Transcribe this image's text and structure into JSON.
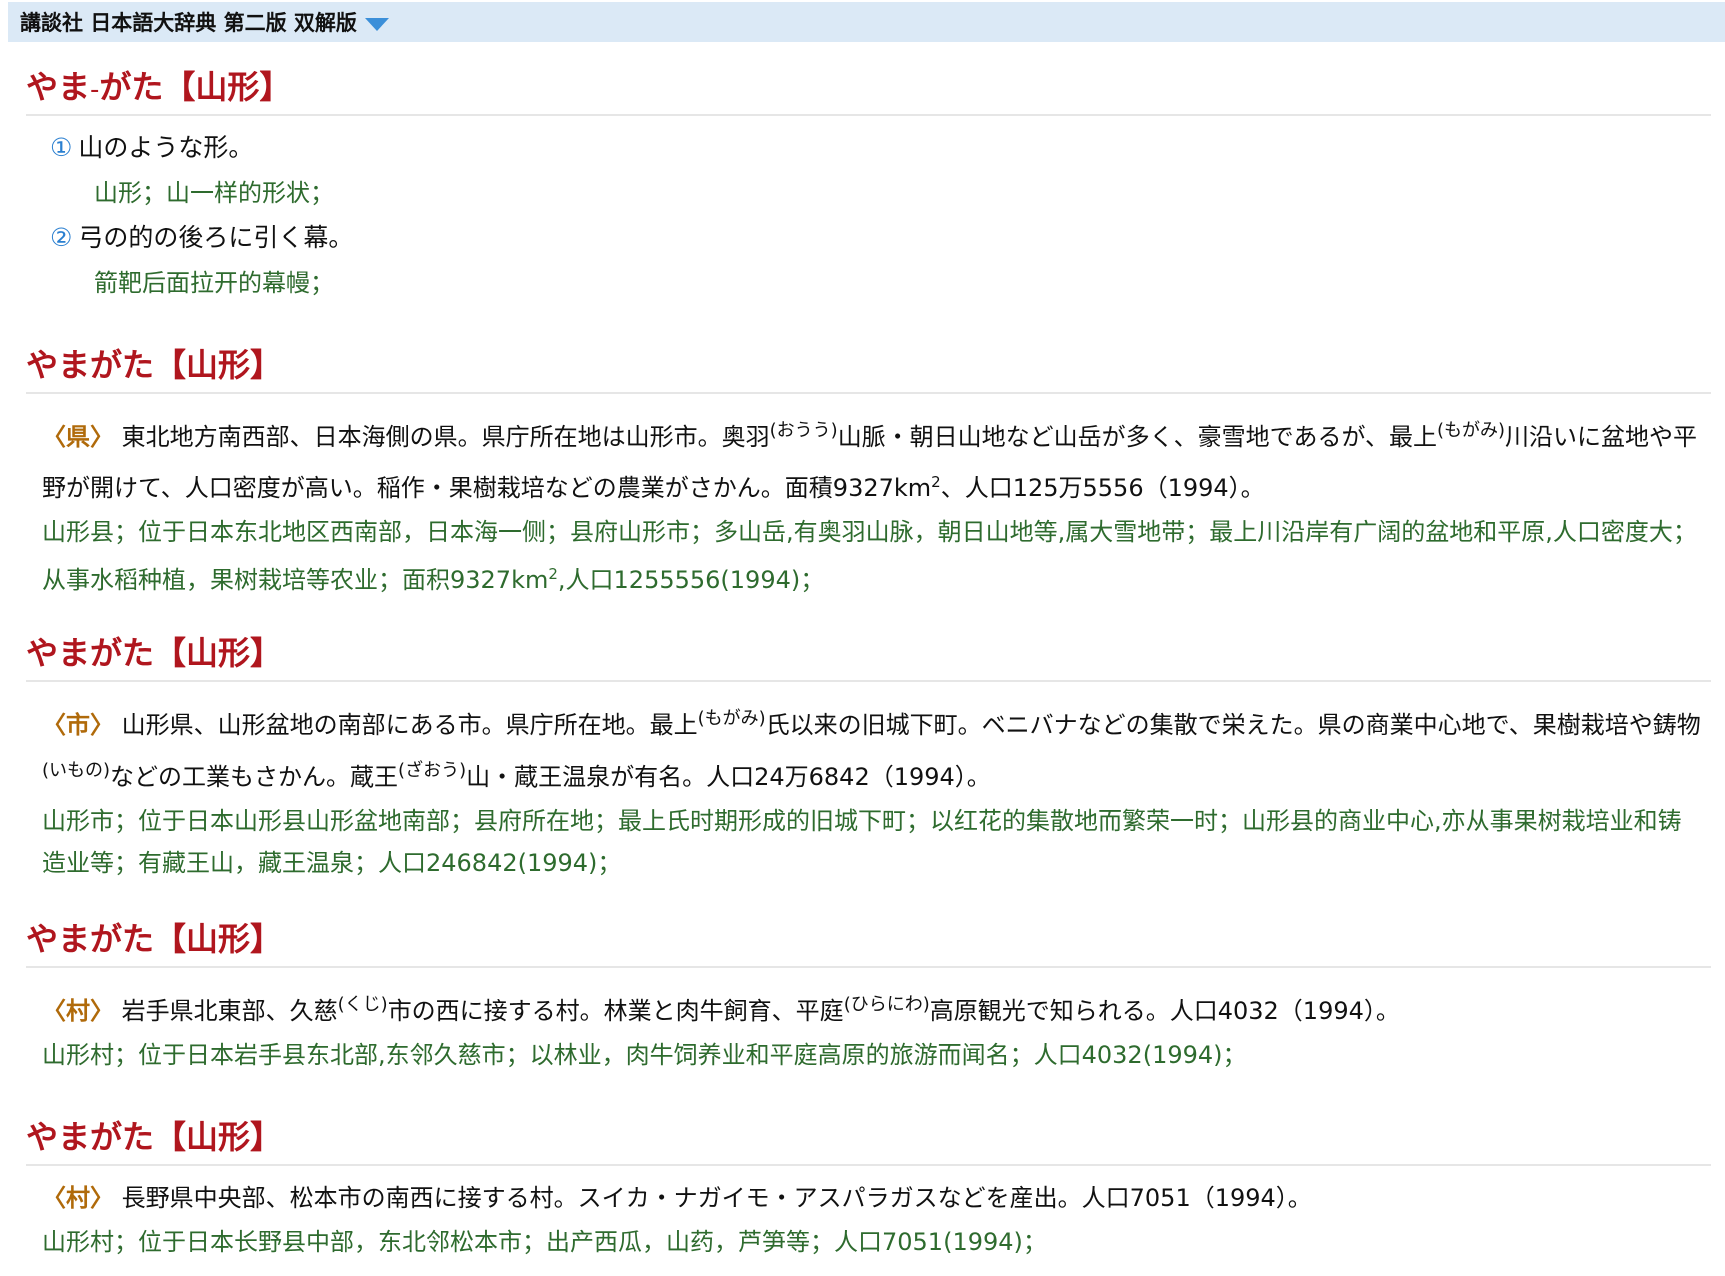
{
  "header": {
    "title": "講談社 日本語大辞典 第二版 双解版",
    "dropdown_icon": "triangle-down-icon"
  },
  "entries": [
    {
      "headword": {
        "kana_a": "やま",
        "dash": "-",
        "kana_b": "がた",
        "kanji": "【山形】"
      },
      "senses": [
        {
          "num": "①",
          "jp": "山のような形。",
          "zh": "山形；山一样的形状；"
        },
        {
          "num": "②",
          "jp": "弓の的の後ろに引く幕。",
          "zh": "箭靶后面拉开的幕幔；"
        }
      ]
    },
    {
      "headword": "やまがた【山形】",
      "category": "〈県〉",
      "jp_parts": [
        "東北地方南西部、日本海側の県。県庁所在地は山形市。奥羽",
        "(おうう)",
        "山脈・朝日山地など山岳が多く、豪雪地であるが、最上",
        "(もがみ)",
        "川沿いに盆地や平野が開けて、人口密度が高い。稲作・果樹栽培などの農業がさかん。面積9327km",
        "2",
        "、人口125万5556（1994）。"
      ],
      "zh_parts": [
        "山形县；位于日本东北地区西南部，日本海一侧；县府山形市；多山岳,有奥羽山脉，朝日山地等,属大雪地带；最上川沿岸有广阔的盆地和平原,人口密度大；从事水稻种植，果树栽培等农业；面积9327km",
        "2",
        ",人口1255556(1994)；"
      ]
    },
    {
      "headword": "やまがた【山形】",
      "category": "〈市〉",
      "jp_parts": [
        "山形県、山形盆地の南部にある市。県庁所在地。最上",
        "(もがみ)",
        "氏以来の旧城下町。ベニバナなどの集散で栄えた。県の商業中心地で、果樹栽培や鋳物",
        "(いもの)",
        "などの工業もさかん。蔵王",
        "(ざおう)",
        "山・蔵王温泉が有名。人口24万6842（1994）。"
      ],
      "zh": "山形市；位于日本山形县山形盆地南部；县府所在地；最上氏时期形成的旧城下町；以红花的集散地而繁荣一时；山形县的商业中心,亦从事果树栽培业和铸造业等；有藏王山，藏王温泉；人口246842(1994)；"
    },
    {
      "headword": "やまがた【山形】",
      "category": "〈村〉",
      "jp_parts": [
        "岩手県北東部、久慈",
        "(くじ)",
        "市の西に接する村。林業と肉牛飼育、平庭",
        "(ひらにわ)",
        "高原観光で知られる。人口4032（1994）。"
      ],
      "zh": "山形村；位于日本岩手县东北部,东邻久慈市；以林业，肉牛饲养业和平庭高原的旅游而闻名；人口4032(1994)；"
    },
    {
      "headword": "やまがた【山形】",
      "category": "〈村〉",
      "jp": "長野県中央部、松本市の南西に接する村。スイカ・ナガイモ・アスパラガスなどを産出。人口7051（1994）。",
      "zh": "山形村；位于日本长野县中部，东北邻松本市；出产西瓜，山药，芦笋等；人口7051(1994)；"
    }
  ]
}
